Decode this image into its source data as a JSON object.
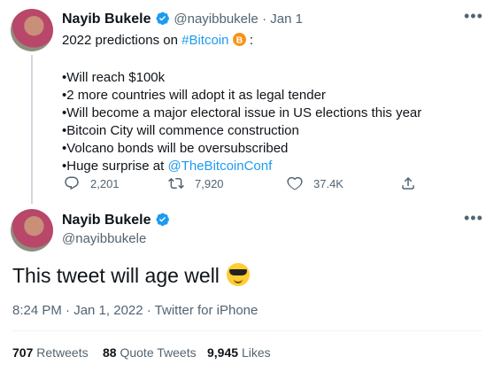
{
  "tweet1": {
    "name": "Nayib Bukele",
    "handle": "@nayibbukele",
    "date": "· Jan 1",
    "line1_prefix": "2022 predictions on",
    "line1_hashtag": "#Bitcoin",
    "line1_suffix": ":",
    "bullets": [
      "•Will reach $100k",
      "•2 more countries will adopt it as legal tender",
      "•Will become a major electoral issue in US elections this year",
      "•Bitcoin City will commence construction",
      "•Volcano bonds will be oversubscribed"
    ],
    "last_bullet_prefix": "•Huge surprise at",
    "last_bullet_mention": "@TheBitcoinConf",
    "replies": "2,201",
    "retweets": "7,920",
    "likes": "37.4K"
  },
  "tweet2": {
    "name": "Nayib Bukele",
    "handle": "@nayibbukele",
    "text": "This tweet will age well",
    "time": "8:24 PM · Jan 1, 2022 · Twitter for iPhone",
    "retweet_count": "707",
    "retweet_label": "Retweets",
    "quote_count": "88",
    "quote_label": "Quote Tweets",
    "likes_count": "9,945",
    "likes_label": "Likes"
  },
  "icons": {
    "verified": "verified-badge-icon",
    "bitcoin": "bitcoin-icon",
    "reply": "reply-icon",
    "retweet": "retweet-icon",
    "like": "heart-icon",
    "share": "share-icon",
    "more": "more-icon",
    "emoji": "sunglasses-emoji"
  },
  "colors": {
    "accent": "#1d9bf0",
    "secondary_text": "#536471",
    "bitcoin": "#f7931a"
  }
}
